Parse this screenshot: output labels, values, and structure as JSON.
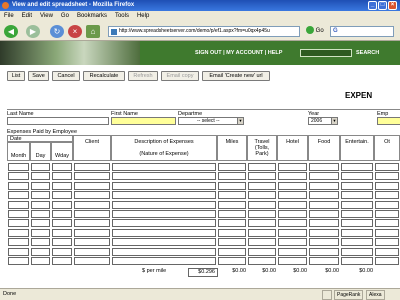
{
  "window": {
    "title": "View and edit spreadsheet - Mozilla Firefox"
  },
  "menu": [
    "File",
    "Edit",
    "View",
    "Go",
    "Bookmarks",
    "Tools",
    "Help"
  ],
  "navbar": {
    "url": "http://www.spreadsheetserver.com/demo/p/ef1.aspx?fm=u0qx4p45u",
    "go_label": "Go",
    "search_label": "G"
  },
  "banner": {
    "links": "SIGN OUT  |  MY ACCOUNT  |  HELP",
    "search_label": "SEARCH"
  },
  "toolbar": [
    {
      "label": "List",
      "enabled": true
    },
    {
      "label": "Save",
      "enabled": true
    },
    {
      "label": "Cancel",
      "enabled": true
    },
    {
      "label": "Recalculate",
      "enabled": true
    },
    {
      "label": "Refresh",
      "enabled": false
    },
    {
      "label": "Email copy",
      "enabled": false
    },
    {
      "label": "Email 'Create new' url",
      "enabled": true
    }
  ],
  "heading": "EXPEN",
  "filters": {
    "last_name_label": "Last Name",
    "first_name_label": "First Name",
    "department_label": "Departme",
    "department_value": "-- select --",
    "year_label": "Year",
    "year_value": "2006",
    "employee_label": "Emp"
  },
  "section_title": "Expenses Paid by Employee",
  "grid": {
    "date_header": "Date",
    "month_header": "Month",
    "day_header": "Day",
    "wday_header": "Wday",
    "client_header": "Client",
    "desc_header": "Description of Expenses",
    "desc_sub_header": "(Nature of Expense)",
    "miles_header": "Miles",
    "travel_header": "Travel (Tolls, Park)",
    "hotel_header": "Hotel",
    "food_header": "Food",
    "entertain_header": "Entertain.",
    "other_header": "Ot"
  },
  "totals": {
    "per_mile_label": "$ per mile",
    "per_mile_value": "$0.296",
    "miles": "$0.00",
    "travel": "$0.00",
    "hotel": "$0.00",
    "food": "$0.00",
    "entertain": "$0.00"
  },
  "status": {
    "text": "Done",
    "pagerank": "PageRank",
    "alexa": "Alexa"
  }
}
